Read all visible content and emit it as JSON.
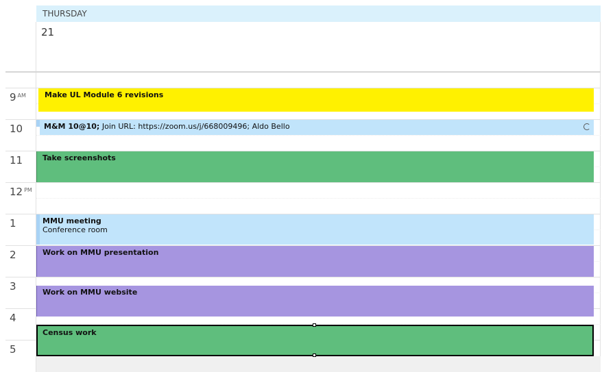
{
  "day": {
    "name": "THURSDAY",
    "number": "21"
  },
  "hours": [
    {
      "label": "9",
      "suffix": "AM"
    },
    {
      "label": "10",
      "suffix": ""
    },
    {
      "label": "11",
      "suffix": ""
    },
    {
      "label": "12",
      "suffix": "PM"
    },
    {
      "label": "1",
      "suffix": ""
    },
    {
      "label": "2",
      "suffix": ""
    },
    {
      "label": "3",
      "suffix": ""
    },
    {
      "label": "4",
      "suffix": ""
    },
    {
      "label": "5",
      "suffix": ""
    }
  ],
  "events": [
    {
      "title": "Make UL Module 6 revisions",
      "location": "",
      "color": "#fff100"
    },
    {
      "title": "M&M 10@10;",
      "detail": " Join URL: https://zoom.us/j/668009496; Aldo Bello",
      "color": "#c1e4fb",
      "icon": "recurring-icon"
    },
    {
      "title": "Take screenshots",
      "location": "",
      "color": "#5fbe7d"
    },
    {
      "title": "MMU meeting",
      "location": "Conference room",
      "color": "#c1e4fb"
    },
    {
      "title": "Work on MMU presentation",
      "location": "",
      "color": "#a695e0"
    },
    {
      "title": "Work on MMU website",
      "location": "",
      "color": "#a695e0"
    },
    {
      "title": "Census work",
      "location": "",
      "color": "#5fbe7d"
    }
  ]
}
